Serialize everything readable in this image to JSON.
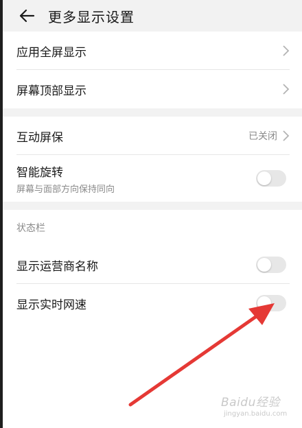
{
  "header": {
    "title": "更多显示设置"
  },
  "group1": {
    "items": [
      {
        "label": "应用全屏显示"
      },
      {
        "label": "屏幕顶部显示"
      }
    ]
  },
  "group2": {
    "items": [
      {
        "label": "互动屏保",
        "value": "已关闭"
      },
      {
        "label": "智能旋转",
        "subtitle": "屏幕与面部方向保持同向",
        "toggle": "off"
      }
    ]
  },
  "status_bar": {
    "title": "状态栏",
    "items": [
      {
        "label": "显示运营商名称",
        "toggle": "off"
      },
      {
        "label": "显示实时网速",
        "toggle": "off"
      }
    ]
  },
  "watermark": {
    "text": "Baidu经验",
    "sub": "jingyan.baidu.com"
  },
  "colors": {
    "accent_arrow": "#e53935",
    "background_gap": "#f2f2f2",
    "toggle_off": "#e7e7e7"
  }
}
